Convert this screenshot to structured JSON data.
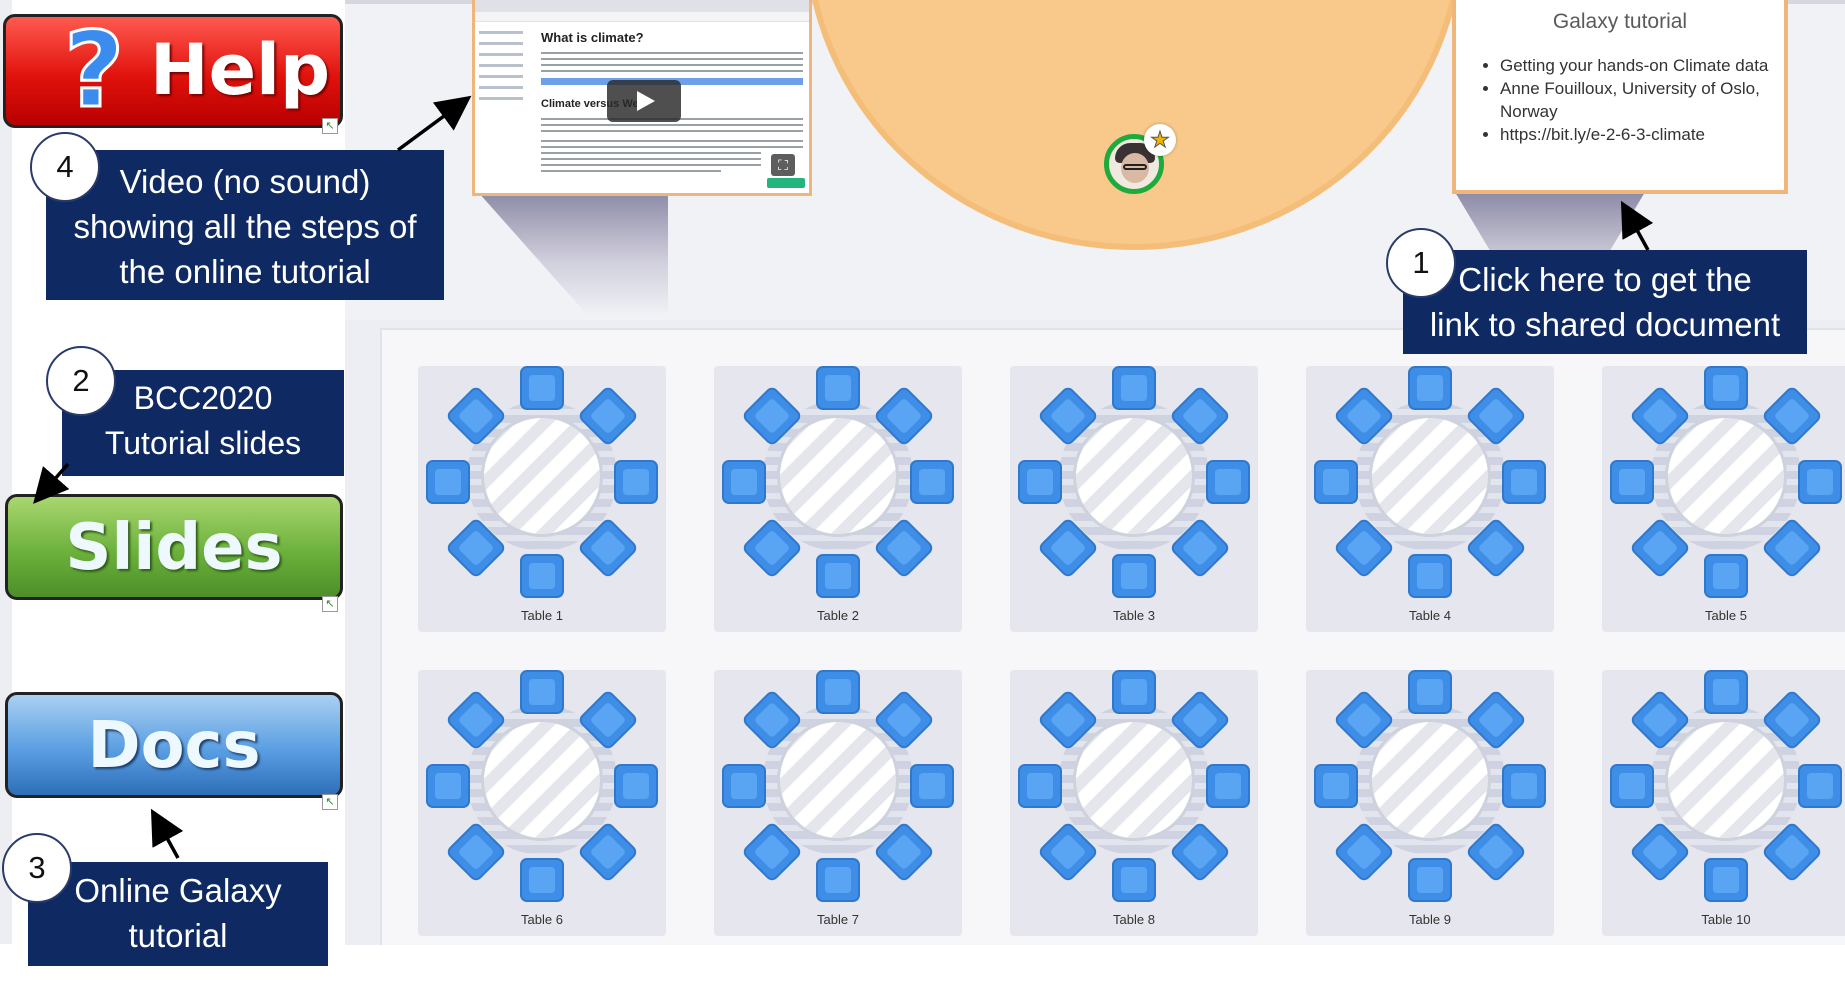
{
  "sidebar": {
    "help_button": {
      "symbol": "?",
      "label": "Help",
      "color": "#e0120c"
    },
    "slides_button": {
      "label": "Slides",
      "color": "#6cb13c"
    },
    "docs_button": {
      "label": "Docs",
      "color": "#5a9ee2"
    }
  },
  "stage": {
    "video_screen": {
      "heading": "What is climate?",
      "subheading": "Climate versus We"
    },
    "doc_screen": {
      "title": "Galaxy tutorial",
      "items": [
        "Getting your hands-on Climate data",
        "Anne Fouilloux, University of Oslo, Norway",
        "https://bit.ly/e-2-6-3-climate"
      ]
    },
    "avatar_badge": "★"
  },
  "tables": [
    {
      "label": "Table 1"
    },
    {
      "label": "Table 2"
    },
    {
      "label": "Table 3"
    },
    {
      "label": "Table 4"
    },
    {
      "label": "Table 5"
    },
    {
      "label": "Table 6"
    },
    {
      "label": "Table 7"
    },
    {
      "label": "Table 8"
    },
    {
      "label": "Table 9"
    },
    {
      "label": "Table 10"
    }
  ],
  "callouts": {
    "c1": {
      "number": "1",
      "line1": "Click here to get the",
      "line2": "link to shared document"
    },
    "c2": {
      "number": "2",
      "line1": "BCC2020",
      "line2": "Tutorial slides"
    },
    "c3": {
      "number": "3",
      "line1": "Online Galaxy",
      "line2": "tutorial"
    },
    "c4": {
      "number": "4",
      "line1": "Video (no sound)",
      "line2": "showing all the steps of",
      "line3": "the online tutorial"
    }
  },
  "colors": {
    "callout_bg": "#0f2a63",
    "stage": "#f8c98b",
    "chair": "#3e8ee8",
    "avatar_ring": "#1faa3c"
  }
}
